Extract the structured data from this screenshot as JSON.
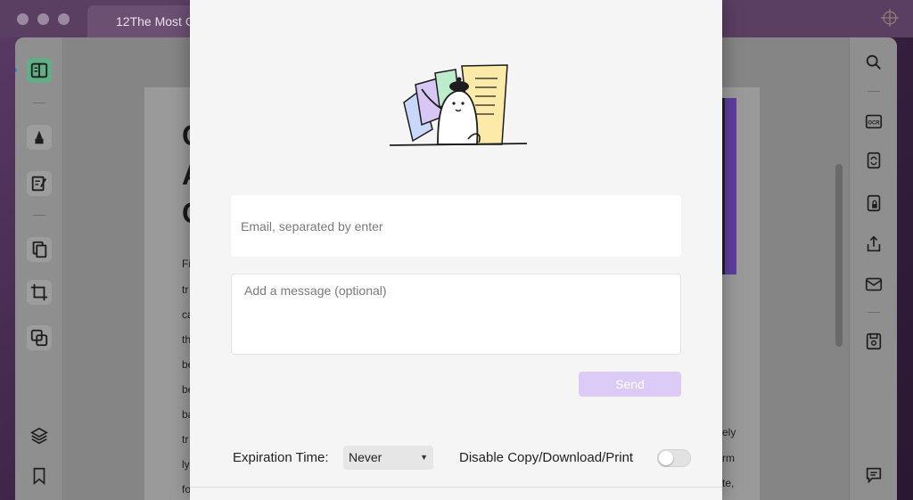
{
  "window": {
    "tab_title": "12The Most C"
  },
  "document": {
    "headings": [
      "C",
      "A",
      "C"
    ],
    "left_lines": [
      "Fi",
      "tr",
      "ca",
      "th",
      "be",
      "be",
      "ba",
      "tr",
      "ly",
      "fo"
    ],
    "right_lines": [
      "ely",
      "rm",
      "te,"
    ]
  },
  "left_rail": {
    "items": [
      {
        "icon": "reader-icon",
        "active": true
      },
      {
        "icon": "highlighter-icon"
      },
      {
        "icon": "edit-icon"
      },
      {
        "icon": "organize-pages-icon"
      },
      {
        "icon": "crop-icon"
      },
      {
        "icon": "convert-icon"
      },
      {
        "icon": "layers-icon"
      },
      {
        "icon": "bookmark-icon"
      }
    ]
  },
  "right_rail": {
    "items": [
      {
        "icon": "search-icon"
      },
      {
        "icon": "ocr-icon",
        "text": "OCR"
      },
      {
        "icon": "convert-sync-icon"
      },
      {
        "icon": "protect-icon"
      },
      {
        "icon": "share-icon"
      },
      {
        "icon": "mail-icon"
      },
      {
        "icon": "save-icon"
      },
      {
        "icon": "comment-icon"
      }
    ]
  },
  "share_dialog": {
    "email_placeholder": "Email, separated by enter",
    "email_value": "",
    "message_placeholder": "Add a message (optional)",
    "message_value": "",
    "send_label": "Send",
    "expiration_label": "Expiration Time:",
    "expiration_value": "Never",
    "disable_label": "Disable Copy/Download/Print",
    "disable_toggle_on": false
  },
  "colors": {
    "send_button_bg": "#dccbf6",
    "accent_green": "#6fc49a"
  }
}
